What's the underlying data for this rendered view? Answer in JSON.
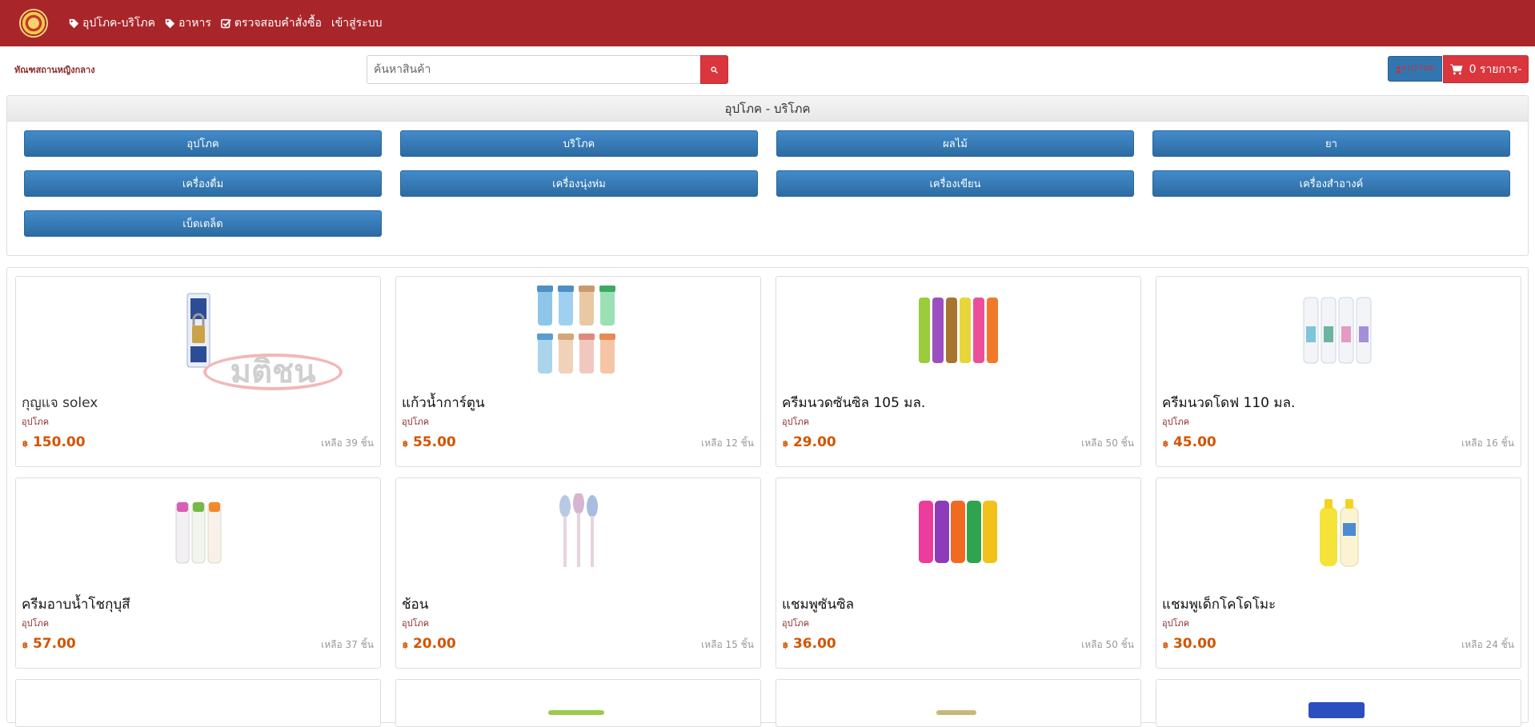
{
  "nav": {
    "items": [
      {
        "label": "อุปโภค-บริโภค",
        "icon": "tag-icon"
      },
      {
        "label": "อาหาร",
        "icon": "tag-icon"
      },
      {
        "label": "ตรวจสอบคำสั่งซื้อ",
        "icon": "checkbox-icon"
      },
      {
        "label": "เข้าสู่ระบบ",
        "icon": ""
      }
    ]
  },
  "header": {
    "shop_name": "ทัณฑสถานหญิงกลาง",
    "search_placeholder": "ค้นหาสินค้า",
    "member_label": "81(2708)",
    "cart_label": "0 รายการ-"
  },
  "categories": {
    "title": "อุปโภค - บริโภค",
    "items": [
      "อุปโภค",
      "บริโภค",
      "ผลไม้",
      "ยา",
      "เครื่องดื่ม",
      "เครื่องนุ่งห่ม",
      "เครื่องเขียน",
      "เครื่องสำอางค์",
      "เบ็ดเตล็ด"
    ]
  },
  "currency": "฿",
  "products": [
    {
      "name": "กุญแจ solex",
      "category": "อุปโภค",
      "price": "150.00",
      "stock": "เหลือ 39 ชิ้น",
      "watermark": "มติชน"
    },
    {
      "name": "แก้วน้ำการ์ตูน",
      "category": "อุปโภค",
      "price": "55.00",
      "stock": "เหลือ 12 ชิ้น"
    },
    {
      "name": "ครีมนวดซันซิล 105 มล.",
      "category": "อุปโภค",
      "price": "29.00",
      "stock": "เหลือ 50 ชิ้น"
    },
    {
      "name": "ครีมนวดโดฟ 110 มล.",
      "category": "อุปโภค",
      "price": "45.00",
      "stock": "เหลือ 16 ชิ้น"
    },
    {
      "name": "ครีมอาบน้ำโชกุบุสึ",
      "category": "อุปโภค",
      "price": "57.00",
      "stock": "เหลือ 37 ชิ้น"
    },
    {
      "name": "ช้อน",
      "category": "อุปโภค",
      "price": "20.00",
      "stock": "เหลือ 15 ชิ้น"
    },
    {
      "name": "แชมพูซันซิล",
      "category": "อุปโภค",
      "price": "36.00",
      "stock": "เหลือ 50 ชิ้น"
    },
    {
      "name": "แชมพูเด็กโคโดโมะ",
      "category": "อุปโภค",
      "price": "30.00",
      "stock": "เหลือ 24 ชิ้น"
    }
  ],
  "colors": {
    "navbar": "#a8262a",
    "primary_button": "#3276b1",
    "danger_button": "#d9363e",
    "price": "#d35400"
  }
}
